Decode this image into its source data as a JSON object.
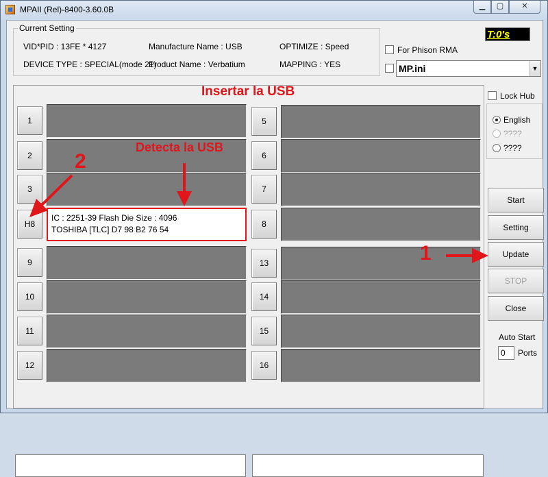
{
  "window": {
    "title": "MPAII (Rel)-8400-3.60.0B",
    "min_glyph": "▁",
    "max_glyph": "▢",
    "close_glyph": "✕"
  },
  "current_setting": {
    "legend": "Current Setting",
    "vid_pid": "VID*PID : 13FE * 4127",
    "manufacture_name": "Manufacture Name : USB",
    "optimize": "OPTIMIZE : Speed",
    "device_type": "DEVICE TYPE : SPECIAL(mode 21)",
    "product_name": "Product Name : Verbatium",
    "mapping": "MAPPING : YES"
  },
  "timer": "T:0's",
  "for_phison_rma": {
    "label": "For Phison RMA",
    "checked": false
  },
  "ini": {
    "checked": false,
    "selected": "MP.ini",
    "arrow": "▼"
  },
  "ports": {
    "left": [
      {
        "label": "1",
        "active": false,
        "lines": []
      },
      {
        "label": "2",
        "active": false,
        "lines": []
      },
      {
        "label": "3",
        "active": false,
        "lines": []
      },
      {
        "label": "H8",
        "active": true,
        "lines": [
          "IC : 2251-39  Flash Die Size : 4096",
          "TOSHIBA [TLC] D7 98 B2 76 54"
        ]
      },
      {
        "label": "9",
        "active": false,
        "lines": []
      },
      {
        "label": "10",
        "active": false,
        "lines": []
      },
      {
        "label": "11",
        "active": false,
        "lines": []
      },
      {
        "label": "12",
        "active": false,
        "lines": []
      }
    ],
    "right": [
      {
        "label": "5"
      },
      {
        "label": "6"
      },
      {
        "label": "7"
      },
      {
        "label": "8"
      },
      {
        "label": "13"
      },
      {
        "label": "14"
      },
      {
        "label": "15"
      },
      {
        "label": "16"
      }
    ]
  },
  "lock_hub": {
    "label": "Lock Hub",
    "checked": false
  },
  "language": {
    "options": [
      {
        "label": "English",
        "selected": true,
        "enabled": true
      },
      {
        "label": "????",
        "selected": false,
        "enabled": false
      },
      {
        "label": "????",
        "selected": false,
        "enabled": true
      }
    ]
  },
  "buttons": {
    "start": "Start",
    "setting": "Setting",
    "update": "Update",
    "stop": "STOP",
    "close": "Close"
  },
  "auto_start": {
    "label": "Auto Start",
    "value": "0",
    "ports_label": "Ports"
  },
  "annotations": {
    "title": "Insertar la USB",
    "detect": "Detecta la USB",
    "step1": "1",
    "step2": "2",
    "color": "#e0161b"
  }
}
